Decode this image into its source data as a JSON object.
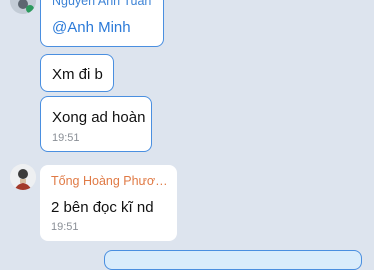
{
  "messages": [
    {
      "sender": "Nguyễn Anh Tuấn",
      "mention": "@Anh Minh"
    },
    {
      "text": "Xm đi b"
    },
    {
      "text": "Xong ad hoàn",
      "time": "19:51"
    },
    {
      "sender": "Tống Hoàng Phươn...",
      "text": "2 bên đọc kĩ nd",
      "time": "19:51"
    }
  ],
  "colors": {
    "background": "#dde4ee",
    "selection_border": "#4a8fe0",
    "sender_blue": "#3d83d6",
    "sender_orange": "#e07a45",
    "own_bubble": "#d9ecfb"
  },
  "icons": [
    "user-avatar-icon",
    "user-avatar-icon"
  ]
}
